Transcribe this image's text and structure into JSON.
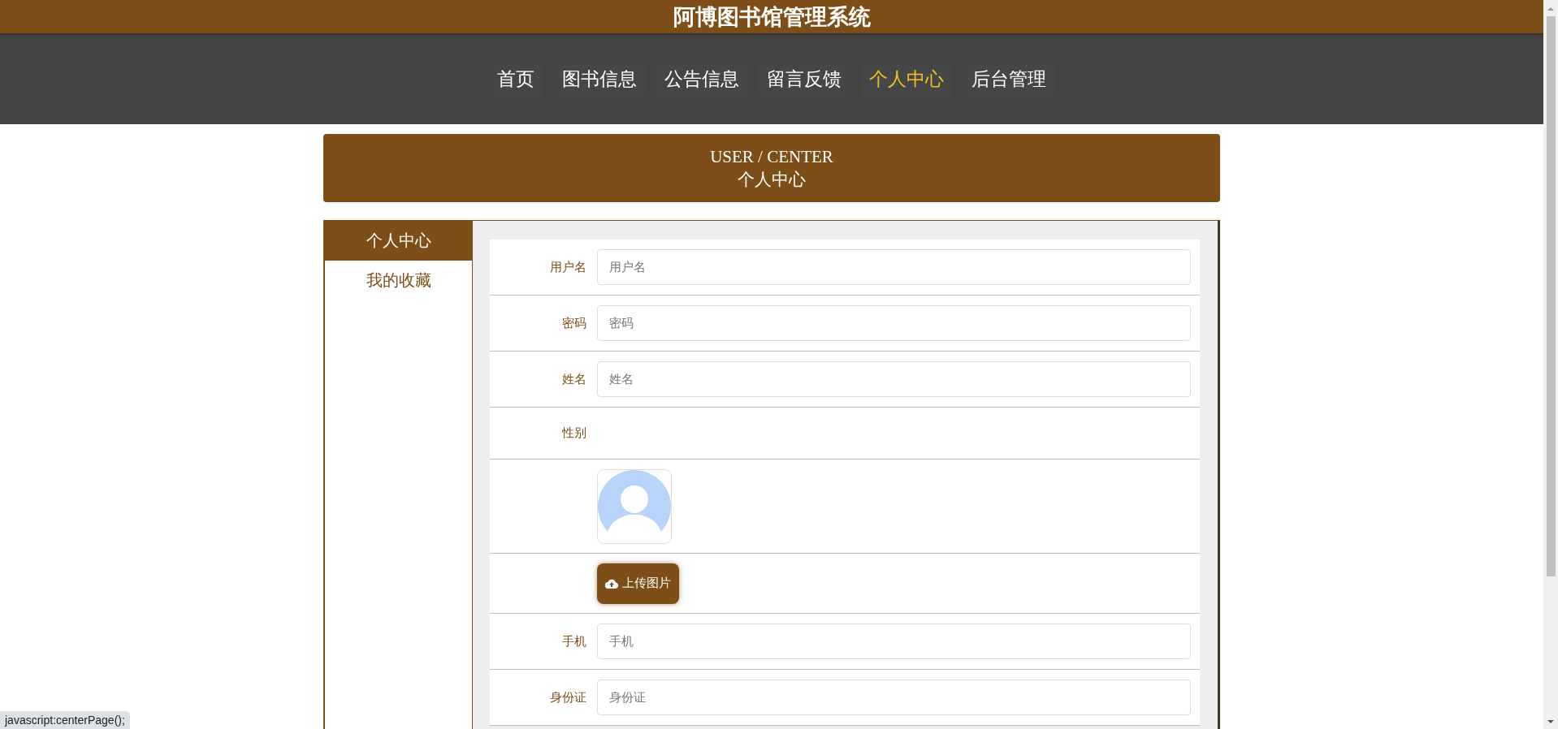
{
  "site_title": "阿博图书馆管理系统",
  "nav": [
    {
      "label": "首页",
      "selected": false
    },
    {
      "label": "图书信息",
      "selected": false
    },
    {
      "label": "公告信息",
      "selected": false
    },
    {
      "label": "留言反馈",
      "selected": false
    },
    {
      "label": "个人中心",
      "selected": true
    },
    {
      "label": "后台管理",
      "selected": false
    }
  ],
  "banner": {
    "subtitle": "USER / CENTER",
    "title": "个人中心"
  },
  "sidebar": {
    "items": [
      {
        "label": "个人中心",
        "selected": true
      },
      {
        "label": "我的收藏",
        "selected": false
      }
    ]
  },
  "form": {
    "fields": [
      {
        "kind": "input",
        "label": "用户名",
        "placeholder": "用户名"
      },
      {
        "kind": "input",
        "label": "密码",
        "placeholder": "密码"
      },
      {
        "kind": "input",
        "label": "姓名",
        "placeholder": "姓名"
      },
      {
        "kind": "text",
        "label": "性别"
      },
      {
        "kind": "avatar"
      },
      {
        "kind": "upload",
        "button": "上传图片"
      },
      {
        "kind": "input",
        "label": "手机",
        "placeholder": "手机"
      },
      {
        "kind": "input",
        "label": "身份证",
        "placeholder": "身份证"
      }
    ]
  },
  "status_bar": "javascript:centerPage();"
}
